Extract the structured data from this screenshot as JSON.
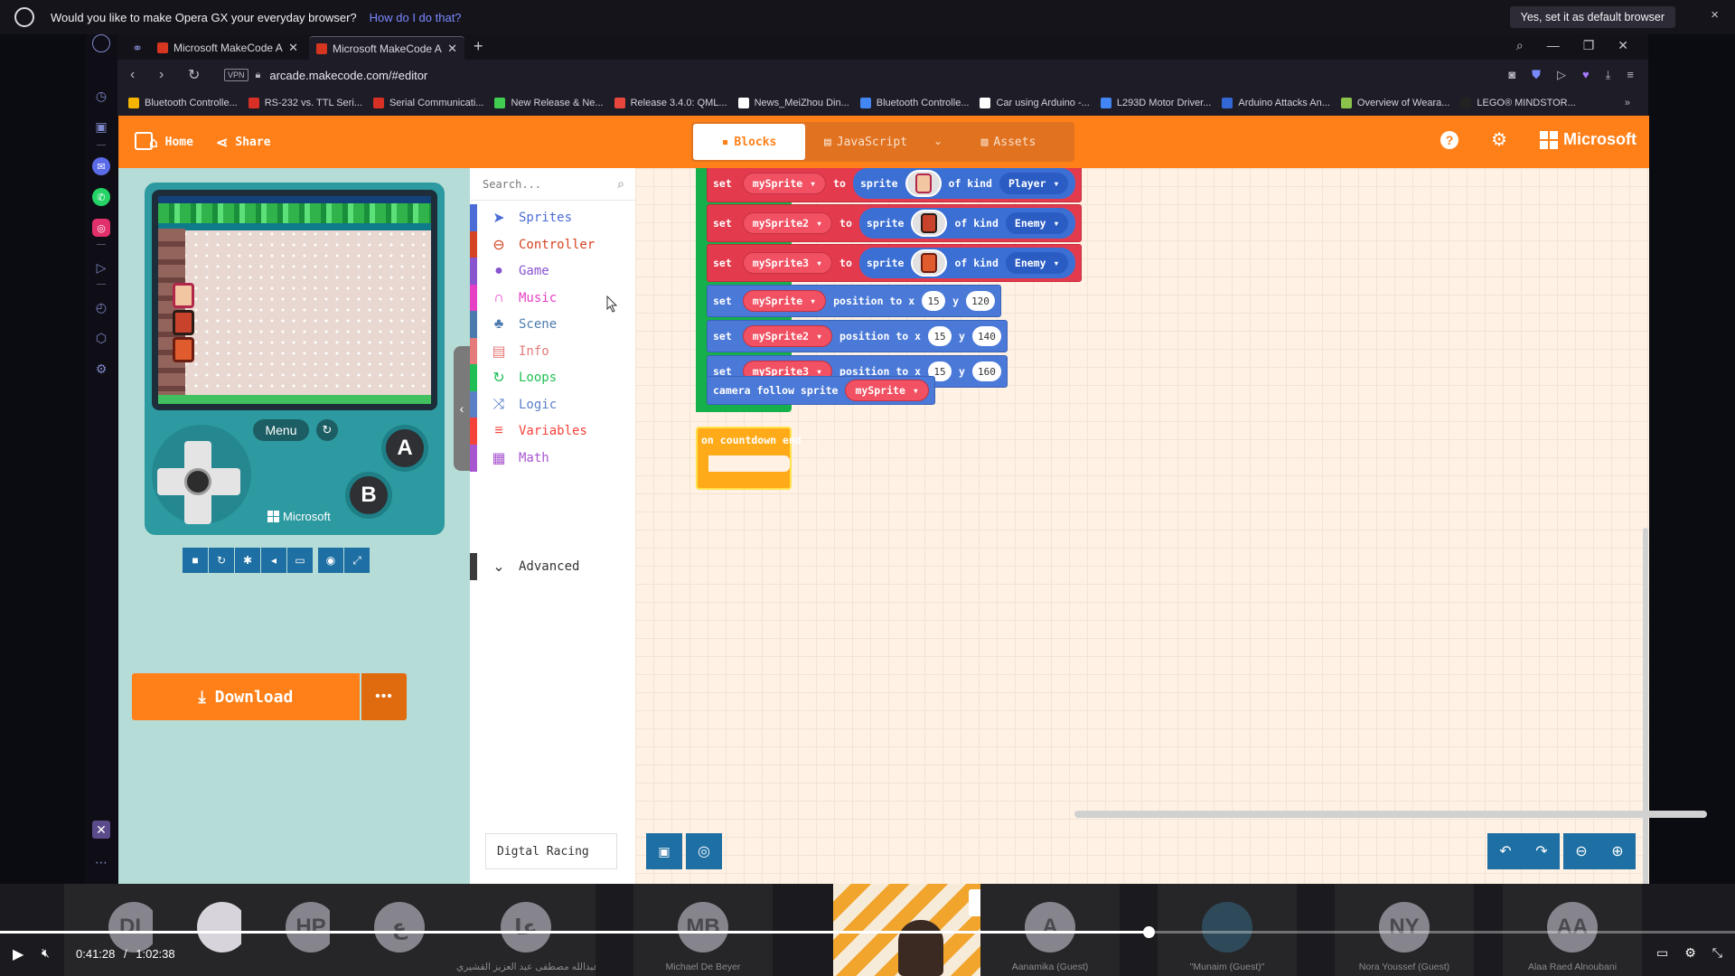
{
  "opera_bar": {
    "question": "Would you like to make Opera GX your everyday browser?",
    "link": "How do I do that?",
    "accept": "Yes, set it as default browser",
    "close": "×"
  },
  "browser": {
    "tabs": [
      {
        "label": "Microsoft MakeCode Arcade",
        "active": false
      },
      {
        "label": "Microsoft MakeCode Arcade",
        "active": true
      }
    ],
    "new_tab": "+",
    "url": "arcade.makecode.com/#editor",
    "vpn": "VPN",
    "bookmarks": [
      {
        "label": "Bluetooth Controlle...",
        "color": "#f4b400"
      },
      {
        "label": "RS-232 vs. TTL Seri...",
        "color": "#d93025"
      },
      {
        "label": "Serial Communicati...",
        "color": "#d93025"
      },
      {
        "label": "New Release & Ne...",
        "color": "#41cd52"
      },
      {
        "label": "Release 3.4.0: QML...",
        "color": "#e8453c"
      },
      {
        "label": "News_MeiZhou Din...",
        "color": "#ffffff"
      },
      {
        "label": "Bluetooth Controlle...",
        "color": "#4285f4"
      },
      {
        "label": "Car using Arduino -...",
        "color": "#ffffff"
      },
      {
        "label": "L293D Motor Driver...",
        "color": "#4285f4"
      },
      {
        "label": "Arduino Attacks An...",
        "color": "#3367d6"
      },
      {
        "label": "Overview of Weara...",
        "color": "#8bc34a"
      },
      {
        "label": "LEGO® MINDSTOR...",
        "color": "#222222"
      }
    ],
    "bookmarks_more": "»"
  },
  "header": {
    "home": "Home",
    "share": "Share",
    "modes": {
      "blocks": "Blocks",
      "javascript": "JavaScript",
      "assets": "Assets"
    },
    "help": "?",
    "settings": "⚙",
    "brand": "Microsoft",
    "accent": "#ff8019"
  },
  "simulator": {
    "menu": "Menu",
    "btn_a": "A",
    "btn_b": "B",
    "brand": "Microsoft",
    "download": "Download",
    "download_more": "•••"
  },
  "toolbox": {
    "search_placeholder": "Search...",
    "categories": [
      {
        "label": "Sprites",
        "color": "#4b6cd6",
        "icon": "paper-plane-icon"
      },
      {
        "label": "Controller",
        "color": "#d54322",
        "icon": "gamepad-icon"
      },
      {
        "label": "Game",
        "color": "#8854d0",
        "icon": "circle-icon"
      },
      {
        "label": "Music",
        "color": "#e63fc5",
        "icon": "headphones-icon"
      },
      {
        "label": "Scene",
        "color": "#4b7bad",
        "icon": "tree-icon"
      },
      {
        "label": "Info",
        "color": "#e57a7a",
        "icon": "id-card-icon"
      },
      {
        "label": "Loops",
        "color": "#20bf55",
        "icon": "loop-icon"
      },
      {
        "label": "Logic",
        "color": "#5b80c8",
        "icon": "shuffle-icon"
      },
      {
        "label": "Variables",
        "color": "#f5423a",
        "icon": "list-icon"
      },
      {
        "label": "Math",
        "color": "#a855d1",
        "icon": "calculator-icon"
      }
    ],
    "advanced": "Advanced"
  },
  "workspace": {
    "set_sprite_rows": [
      {
        "var": "mySprite",
        "kind": "Player"
      },
      {
        "var": "mySprite2",
        "kind": "Enemy"
      },
      {
        "var": "mySprite3",
        "kind": "Enemy"
      }
    ],
    "position_rows": [
      {
        "var": "mySprite",
        "x": "15",
        "y": "120"
      },
      {
        "var": "mySprite2",
        "x": "15",
        "y": "140"
      },
      {
        "var": "mySprite3",
        "x": "15",
        "y": "160"
      }
    ],
    "words": {
      "set": "set",
      "to": "to",
      "sprite": "sprite",
      "of_kind": "of kind",
      "position_to_x": "position to x",
      "y": "y",
      "camera_follow": "camera follow sprite",
      "camera_var": "mySprite",
      "countdown": "on countdown end"
    }
  },
  "bottom": {
    "project_name": "Digtal Racing"
  },
  "participants": [
    {
      "initials": "DL",
      "name": ""
    },
    {
      "initials": "",
      "name": ""
    },
    {
      "initials": "HP",
      "name": ""
    },
    {
      "initials": "ع",
      "name": ""
    },
    {
      "initials": "عا",
      "name": "عبدالله مصطفى عبد العزيز القشيري"
    },
    {
      "initials": "MB",
      "name": "Michael De Beyer"
    },
    {
      "initials": "A",
      "name": "Aanamika (Guest)"
    },
    {
      "initials": "",
      "name": "\"Munaim (Guest)\""
    },
    {
      "initials": "NY",
      "name": "Nora Youssef (Guest)"
    },
    {
      "initials": "AA",
      "name": "Alaa Raed Alnoubani"
    }
  ],
  "player": {
    "current_time": "0:41:28",
    "separator": "/",
    "total_time": "1:02:38",
    "progress_fraction": 0.662
  }
}
